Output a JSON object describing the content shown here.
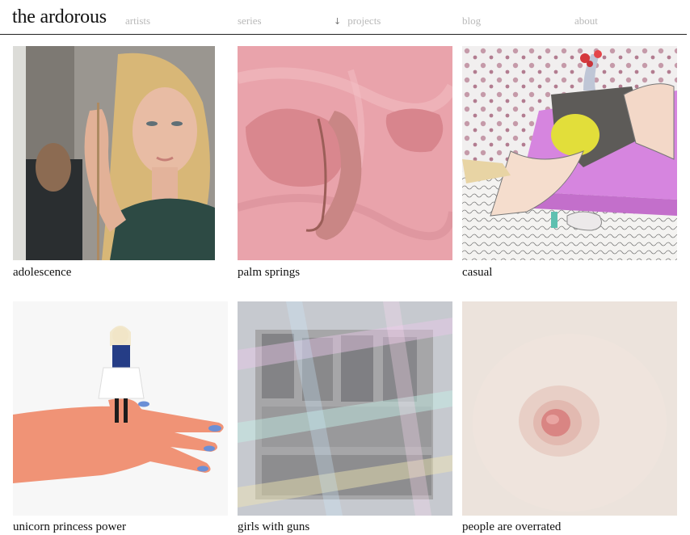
{
  "header": {
    "site_title": "the ardorous",
    "nav": {
      "artists": "artists",
      "series": "series",
      "projects_arrow": "↓",
      "projects": "projects",
      "blog": "blog",
      "about": "about"
    }
  },
  "gallery": {
    "items": [
      {
        "caption": "adolescence"
      },
      {
        "caption": "palm springs"
      },
      {
        "caption": "casual"
      },
      {
        "caption": "unicorn princess power"
      },
      {
        "caption": "girls with guns"
      },
      {
        "caption": "people are overrated"
      }
    ]
  }
}
